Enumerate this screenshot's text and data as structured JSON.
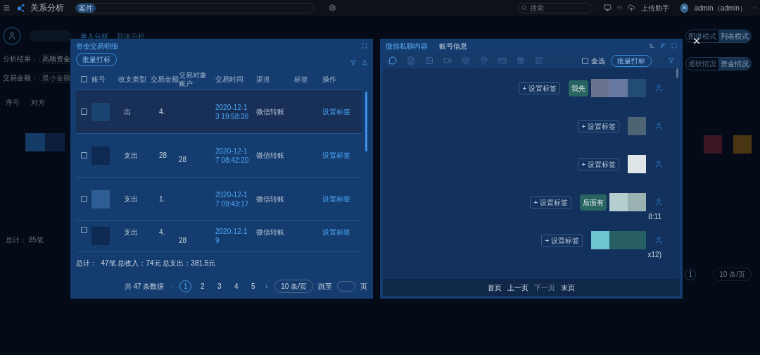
{
  "app": {
    "title": "关系分析",
    "case_badge": "案件",
    "search_placeholder": "搜索",
    "upload": "上传助手",
    "avatar_letter": "a",
    "user": "admin（admin）"
  },
  "background": {
    "tabs": [
      {
        "label": "单人分析",
        "selected": true
      },
      {
        "label": "群体分析",
        "selected": false
      }
    ],
    "filters": [
      {
        "label": "分析结果：",
        "value": "高频资金"
      },
      {
        "label": "交易金额：",
        "placeholder": "最小金额"
      }
    ],
    "column_1": "序号",
    "column_2": "对方",
    "summary": "总计： 85笔",
    "view_modes": [
      {
        "label": "图谱模式",
        "selected": false
      },
      {
        "label": "列表模式",
        "selected": true
      }
    ],
    "info_modes": [
      {
        "label": "通联情况",
        "selected": false
      },
      {
        "label": "资金情况",
        "selected": true
      }
    ],
    "page": "1",
    "page_size": "10 条/页"
  },
  "transactions": {
    "title": "资金交易明细",
    "batch_button": "批量打标",
    "select_all_checked": false,
    "columns": [
      "账号",
      "收支类型",
      "交易金额",
      "交易对象账户",
      "交易时间",
      "渠道",
      "标签",
      "操作"
    ],
    "rows": [
      {
        "selected": true,
        "checked": false,
        "type": "出",
        "amount": "4.",
        "time": "2020-12-13 19:58:26",
        "channel": "微信转账",
        "action": "设置标签"
      },
      {
        "selected": false,
        "checked": false,
        "type": "支出",
        "amount": "28",
        "counterpart": "28",
        "time": "2020-12-17 08:42:20",
        "channel": "微信转账",
        "action": "设置标签"
      },
      {
        "selected": false,
        "checked": false,
        "type": "支出",
        "amount": "1.",
        "time": "2020-12-17 09:43:17",
        "channel": "微信转账",
        "action": "设置标签"
      },
      {
        "selected": false,
        "checked": false,
        "type": "支出",
        "amount": "4.",
        "counterpart": "28",
        "time": "2020-12-19",
        "channel": "微信转账",
        "action": "设置标签"
      }
    ],
    "summary": "总计：  47笔 总收入：74元 总支出：381.5元",
    "total": "共 47 条数据",
    "pages": [
      {
        "label": "1",
        "selected": true
      },
      {
        "label": "2",
        "selected": false
      },
      {
        "label": "3",
        "selected": false
      },
      {
        "label": "4",
        "selected": false
      },
      {
        "label": "5",
        "selected": false
      }
    ],
    "page_size": "10 条/页",
    "jump_label": "跳至",
    "page_unit": "页"
  },
  "chat": {
    "tabs": [
      {
        "label": "微信私聊内容",
        "selected": true
      },
      {
        "label": "账号信息",
        "selected": false
      }
    ],
    "select_all": {
      "label": "全选",
      "checked": false
    },
    "batch_button": "批量打标",
    "messages": [
      {
        "tag_button": "+ 设置标签",
        "text": "我先"
      },
      {
        "tag_button": "+ 设置标签"
      },
      {
        "tag_button": "+ 设置标签"
      },
      {
        "tag_button": "+ 设置标签",
        "text": "后面有",
        "note": "8:11"
      },
      {
        "tag_button": "+ 设置标签",
        "note": "x12)"
      }
    ],
    "pager": [
      {
        "label": "首页",
        "disabled": false
      },
      {
        "label": "上一页",
        "disabled": false
      },
      {
        "label": "下一页",
        "disabled": true
      },
      {
        "label": "末页",
        "disabled": false
      }
    ]
  }
}
